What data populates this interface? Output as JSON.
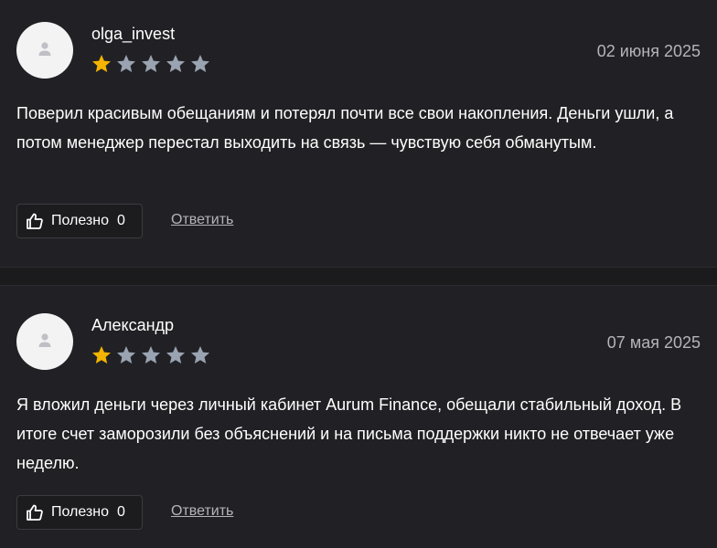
{
  "colors": {
    "background": "#212125",
    "star_filled": "#f5b301",
    "star_empty": "#9aa3b1",
    "text_secondary": "#b4b4b9"
  },
  "reviews": [
    {
      "username": "olga_invest",
      "date": "02 июня 2025",
      "rating": 1,
      "rating_max": 5,
      "text": "Поверил красивым обещаниям и потерял почти все свои накопления. Деньги ушли, а потом менеджер перестал выходить на связь — чувствую себя обманутым.",
      "useful_label": "Полезно",
      "useful_count": "0",
      "reply_label": "Ответить",
      "avatar_icon": "user-icon",
      "useful_icon": "thumbs-up-icon"
    },
    {
      "username": "Александр",
      "date": "07 мая 2025",
      "rating": 1,
      "rating_max": 5,
      "text": "Я вложил деньги через личный кабинет Aurum Finance, обещали стабильный доход. В итоге счет заморозили без объяснений и на письма поддержки никто не отвечает уже неделю.",
      "useful_label": "Полезно",
      "useful_count": "0",
      "reply_label": "Ответить",
      "avatar_icon": "user-icon",
      "useful_icon": "thumbs-up-icon"
    }
  ]
}
